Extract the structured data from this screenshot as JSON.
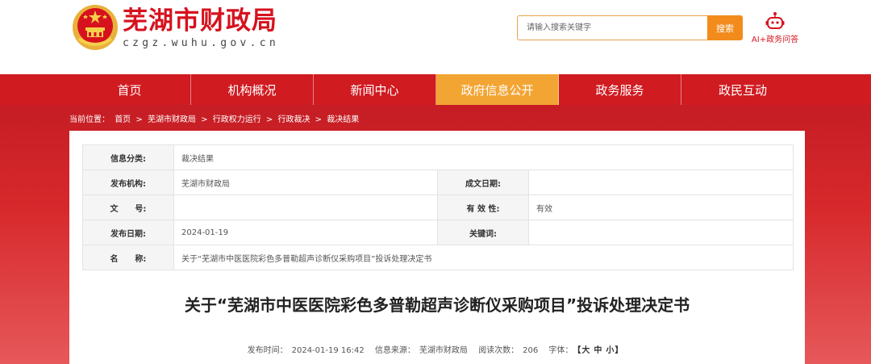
{
  "header": {
    "site_title": "芜湖市财政局",
    "site_domain": "czgz.wuhu.gov.cn",
    "search_placeholder": "请输入搜索关键字",
    "search_button": "搜索",
    "ai_label": "AI+政务问答",
    "brand_color": "#d6121e"
  },
  "nav": {
    "items": [
      {
        "label": "首页"
      },
      {
        "label": "机构概况"
      },
      {
        "label": "新闻中心"
      },
      {
        "label": "政府信息公开"
      },
      {
        "label": "政务服务"
      },
      {
        "label": "政民互动"
      }
    ],
    "active_index": 3,
    "bg_color": "#d01b21",
    "active_color": "#f3a534"
  },
  "breadcrumb": {
    "prefix": "当前位置：",
    "items": [
      "首页",
      "芜湖市财政局",
      "行政权力运行",
      "行政裁决",
      "裁决结果"
    ],
    "separator": ">"
  },
  "info": {
    "category_label": "信息分类:",
    "category_value": "裁决结果",
    "publisher_label": "发布机构:",
    "publisher_value": "芜湖市财政局",
    "written_date_label": "成文日期:",
    "written_date_value": "",
    "doc_no_label": "文      号:",
    "doc_no_value": "",
    "validity_label": "有 效 性:",
    "validity_value": "有效",
    "publish_date_label": "发布日期:",
    "publish_date_value": "2024-01-19",
    "keywords_label": "关键词:",
    "keywords_value": "",
    "name_label": "名      称:",
    "name_value": "关于“芜湖市中医医院彩色多普勒超声诊断仪采购项目”投诉处理决定书"
  },
  "article": {
    "title": "关于“芜湖市中医医院彩色多普勒超声诊断仪采购项目”投诉处理决定书",
    "publish_time_label": "发布时间：",
    "publish_time": "2024-01-19 16:42",
    "source_label": "信息来源：",
    "source": "芜湖市财政局",
    "views_label": "阅读次数：",
    "views": "206",
    "font_label": "字体：",
    "font_open": "【",
    "font_large": "大",
    "font_medium": "中",
    "font_small": "小",
    "font_close": "】"
  }
}
